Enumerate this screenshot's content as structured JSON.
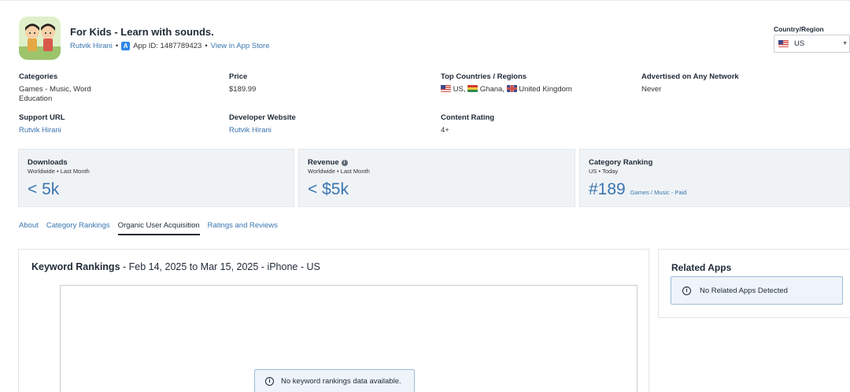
{
  "app": {
    "title": "For Kids - Learn with sounds.",
    "developer": "Rutvik Hirani",
    "app_id": "App ID: 1487789423",
    "store_link": "View in App Store",
    "separator": "•"
  },
  "country": {
    "label": "Country/Region",
    "selected": "US"
  },
  "info": {
    "categories_label": "Categories",
    "categories_value_1": "Games - Music, Word",
    "categories_value_2": "Education",
    "price_label": "Price",
    "price_value": "$189.99",
    "top_countries_label": "Top Countries / Regions",
    "top_countries": [
      "US,",
      "Ghana,",
      "United Kingdom"
    ],
    "advertised_label": "Advertised on Any Network",
    "advertised_value": "Never",
    "support_label": "Support URL",
    "support_value": "Rutvik Hirani",
    "dev_site_label": "Developer Website",
    "dev_site_value": "Rutvik Hirani",
    "content_rating_label": "Content Rating",
    "content_rating_value": "4+"
  },
  "stats": {
    "downloads": {
      "title": "Downloads",
      "sub": "Worldwide • Last Month",
      "value": "< 5k"
    },
    "revenue": {
      "title": "Revenue",
      "sub": "Worldwide • Last Month",
      "value": "< $5k"
    },
    "ranking": {
      "title": "Category Ranking",
      "sub": "US • Today",
      "value": "#189",
      "category": "Games / Music - Paid"
    }
  },
  "tabs": [
    "About",
    "Category Rankings",
    "Organic User Acquisition",
    "Ratings and Reviews"
  ],
  "keywords": {
    "title": "Keyword Rankings",
    "range": " - Feb 14, 2025 to Mar 15, 2025 - iPhone - US",
    "empty_msg": "No keyword rankings data available."
  },
  "related": {
    "title": "Related Apps",
    "empty_msg": "No Related Apps Detected"
  }
}
